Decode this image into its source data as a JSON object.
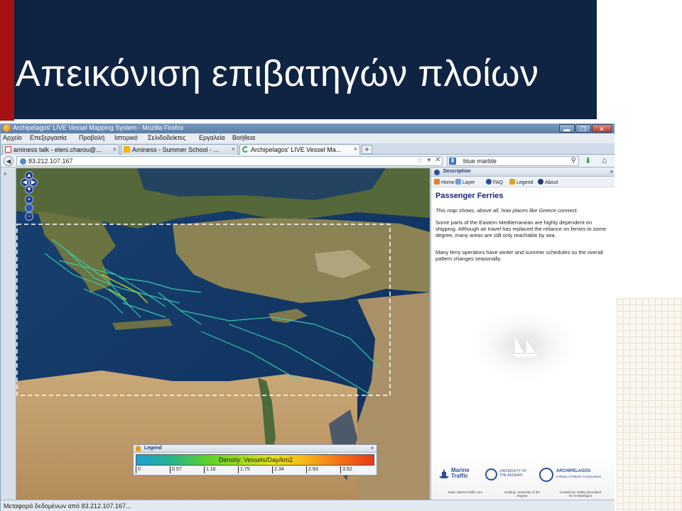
{
  "slide": {
    "title": "Απεικόνιση επιβατηγών πλοίων",
    "colors": {
      "title_bar": "#0f2342",
      "stripe": "#a41212"
    }
  },
  "browser": {
    "window_title": "Archipelagos' LIVE Vessel Mapping System - Mozilla Firefox",
    "window_controls": [
      "▬",
      "❐",
      "✕"
    ],
    "menu": [
      "Αρχείο",
      "Επεξεργασία",
      "Προβολή",
      "Ιστορικό",
      "Σελιδοδείκτες",
      "Εργαλεία",
      "Βοήθεια"
    ],
    "tabs": [
      {
        "label": "aminess talk - eleni.charou@...",
        "icon": "gmail-icon",
        "active": false
      },
      {
        "label": "Aminess - Summer School - ...",
        "icon": "slides-icon",
        "active": false
      },
      {
        "label": "Archipelagos' LIVE Vessel Ma...",
        "icon": "loading-icon",
        "active": true
      }
    ],
    "tab_close": "×",
    "new_tab": "+",
    "url": "83.212.107.167",
    "search_value": "blue marble",
    "search_engine_badge": "8",
    "status": "Μεταφορά δεδομένων από 83.212.107.167..."
  },
  "legend": {
    "title": "Legend",
    "close": "×",
    "gradient_label": "Density: Vessels/Day/km2",
    "ticks": [
      "0",
      "0.57",
      "1.16",
      "1.75",
      "2.34",
      "2.93",
      "3.52"
    ],
    "gradient_colors": [
      "#1f9fd3",
      "#5bd12a",
      "#e9e21a",
      "#e8381a"
    ]
  },
  "description": {
    "header": "Description",
    "collapse": "»",
    "nav": [
      "Home",
      "Layer",
      "FAQ",
      "Legend",
      "About"
    ],
    "title": "Passenger Ferries",
    "paragraphs": [
      "This map shows, above all, how places like Greece connect.",
      "Some parts of the Eastern Mediterranean are highly dependent on shipping. Although air travel has replaced the reliance on ferries to some degree, many areas are still only reachable by sea.",
      "Many ferry operators have winter and summer schedules so the overall pattern changes seasonally."
    ],
    "footer": {
      "marinetraffic": "Marine Traffic",
      "aegean": "UNIVERSITY OF THE AEGEAN",
      "archipelagos": "ARCHIPELAGOS",
      "archipelagos_sub": "Institute of Marine Conservation",
      "credits": [
        "Data: MarineTraffic.com",
        "Hosting: University of the Aegean",
        "Created by: Ridley Woodland for Archipelagos"
      ]
    }
  },
  "map": {
    "sidebar_toggle": "»",
    "controls": [
      "▲",
      "◀",
      "▶",
      "▼",
      "+",
      "−"
    ]
  }
}
